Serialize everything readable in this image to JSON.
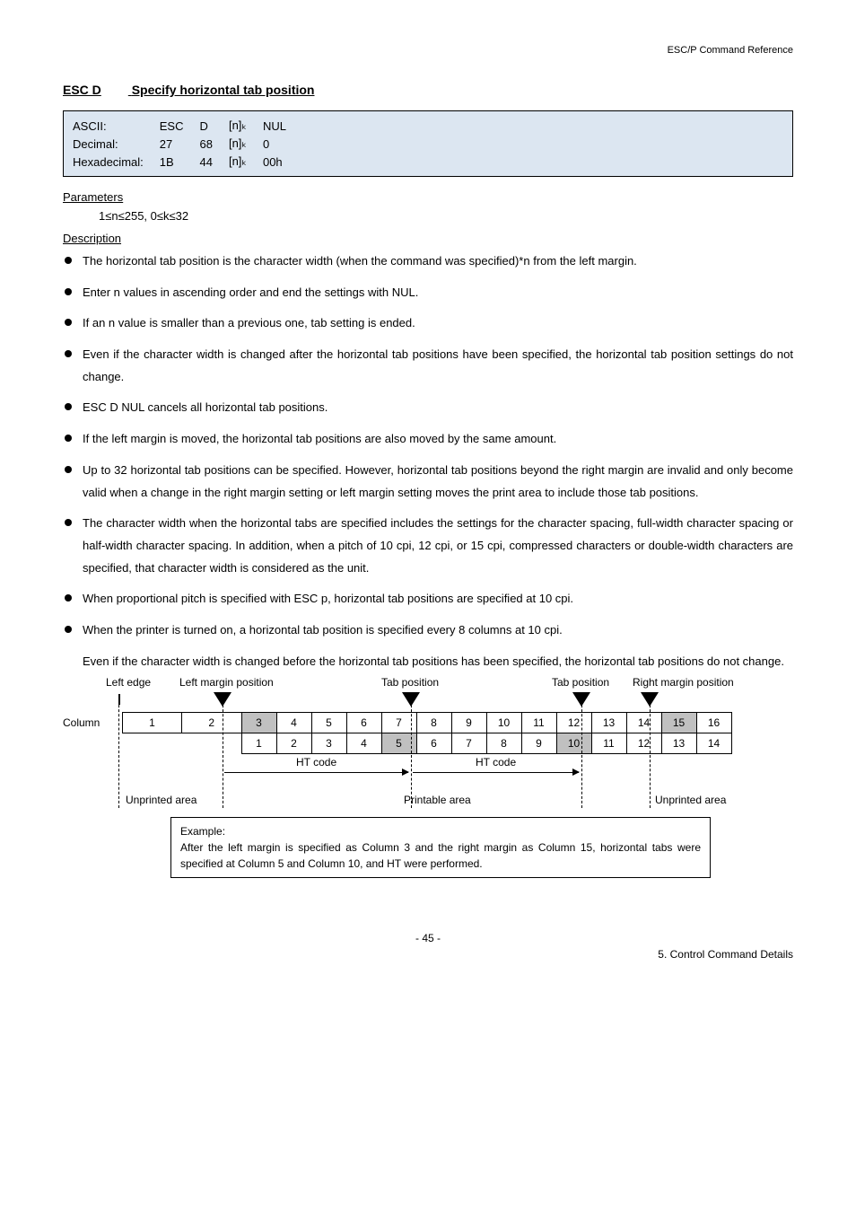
{
  "header": {
    "ref": "ESC/P Command Reference"
  },
  "section": {
    "label": "ESC D",
    "title": "Specify horizontal tab position"
  },
  "codes": {
    "r1": {
      "c1": "ASCII:",
      "c2": "ESC",
      "c3": "D",
      "c4": "[n]ₖ",
      "c5": "NUL"
    },
    "r2": {
      "c1": "Decimal:",
      "c2": "27",
      "c3": "68",
      "c4": "[n]ₖ",
      "c5": "0"
    },
    "r3": {
      "c1": "Hexadecimal:",
      "c2": "1B",
      "c3": "44",
      "c4": "[n]ₖ",
      "c5": "00h"
    }
  },
  "parameters": {
    "heading": "Parameters",
    "text": "1≤n≤255, 0≤k≤32"
  },
  "description": {
    "heading": "Description",
    "items": [
      "The horizontal tab position is the character width (when the command was specified)*n from the left margin.",
      "Enter n values in ascending order and end the settings with NUL.",
      "If an n value is smaller than a previous one, tab setting is ended.",
      "Even if the character width is changed after the horizontal tab positions have been specified, the horizontal tab position settings do not change.",
      "ESC D NUL cancels all horizontal tab positions.",
      "If the left margin is moved, the horizontal tab positions are also moved by the same amount.",
      "Up to 32 horizontal tab positions can be specified. However, horizontal tab positions beyond the right margin are invalid and only become valid when a change in the right margin setting or left margin setting moves the print area to include those tab positions.",
      "The character width when the horizontal tabs are specified includes the settings for the character spacing, full-width character spacing or half-width character spacing. In addition, when a pitch of 10 cpi, 12 cpi, or 15 cpi, compressed characters or double-width characters are specified, that character width is considered as the unit.",
      "When proportional pitch is specified with ESC p, horizontal tab positions are specified at 10 cpi.",
      "When the printer is turned on, a horizontal tab position is specified every 8 columns at 10 cpi."
    ],
    "continuation": "Even if the character width is changed before the horizontal tab positions has been specified, the horizontal tab positions do not change."
  },
  "diagram": {
    "labels": {
      "left_edge": "Left edge",
      "left_margin": "Left margin position",
      "tab1": "Tab position",
      "tab2": "Tab position",
      "right_margin": "Right margin position"
    },
    "row1_head": "Column",
    "row1": [
      "1",
      "2",
      "3",
      "4",
      "5",
      "6",
      "7",
      "8",
      "9",
      "10",
      "11",
      "12",
      "13",
      "14",
      "15",
      "16"
    ],
    "row2": [
      "1",
      "2",
      "3",
      "4",
      "5",
      "6",
      "7",
      "8",
      "9",
      "10",
      "11",
      "12",
      "13",
      "14"
    ],
    "ht": "HT code",
    "unprinted": "Unprinted area",
    "printable": "Printable area"
  },
  "example": {
    "title": "Example:",
    "body": "After the left margin is specified as Column 3 and the right margin as Column 15, horizontal tabs were specified at Column 5 and Column 10, and HT were performed."
  },
  "footer": {
    "page": "- 45 -",
    "chapter": "5. Control Command Details"
  }
}
